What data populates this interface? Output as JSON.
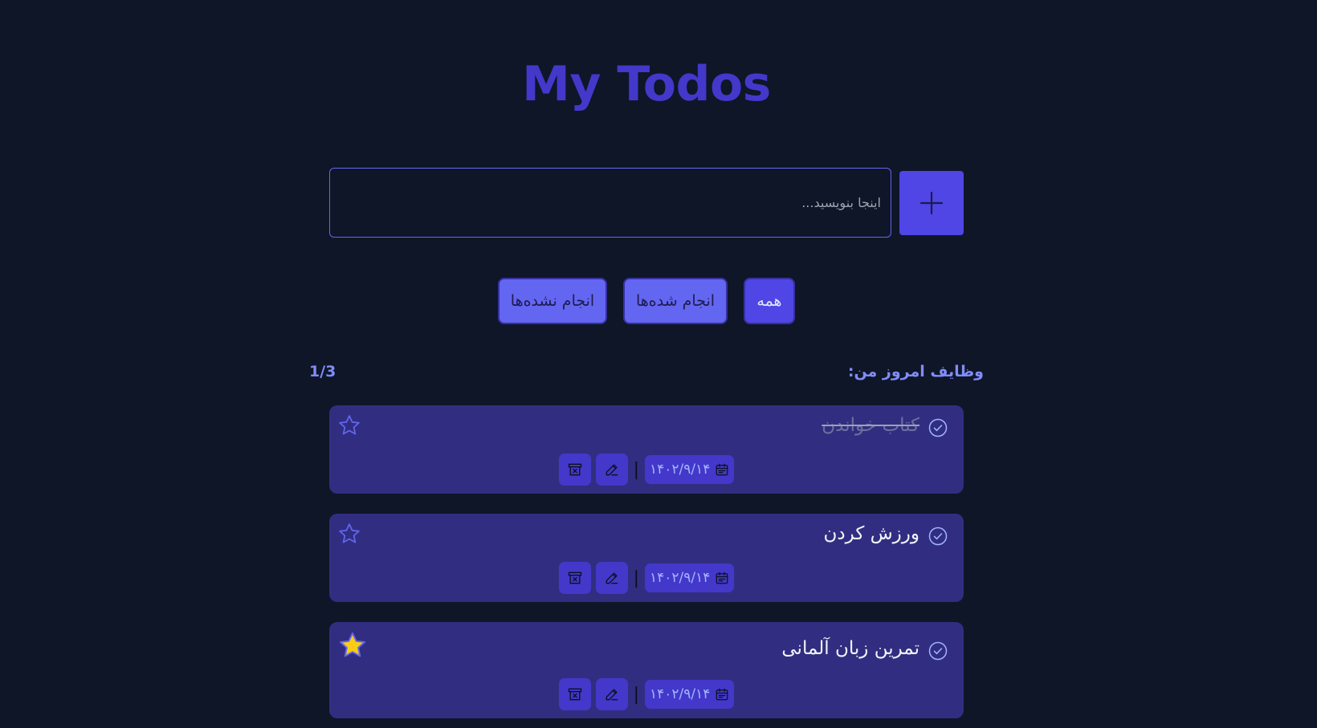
{
  "app": {
    "title": "My Todos"
  },
  "composer": {
    "placeholder": "اینجا بنویسید...",
    "add_icon": "plus-icon"
  },
  "filters": [
    {
      "label": "انجام نشده‌ها",
      "active": false
    },
    {
      "label": "انجام شده‌ها",
      "active": false
    },
    {
      "label": "همه",
      "active": true
    }
  ],
  "list": {
    "heading": "وظایف امروز من:",
    "counter": "1/3"
  },
  "todos": [
    {
      "text": "کتاب خواندن",
      "done": true,
      "starred": false,
      "date": "۱۴۰۲/۹/۱۴"
    },
    {
      "text": "ورزش کردن",
      "done": false,
      "starred": false,
      "date": "۱۴۰۲/۹/۱۴"
    },
    {
      "text": "تمرین زبان آلمانی",
      "done": false,
      "starred": true,
      "date": "۱۴۰۲/۹/۱۴"
    }
  ],
  "colors": {
    "background": "#0e1628",
    "accent": "#4f46e5",
    "card": "#312e81",
    "star_filled": "#facc15"
  }
}
